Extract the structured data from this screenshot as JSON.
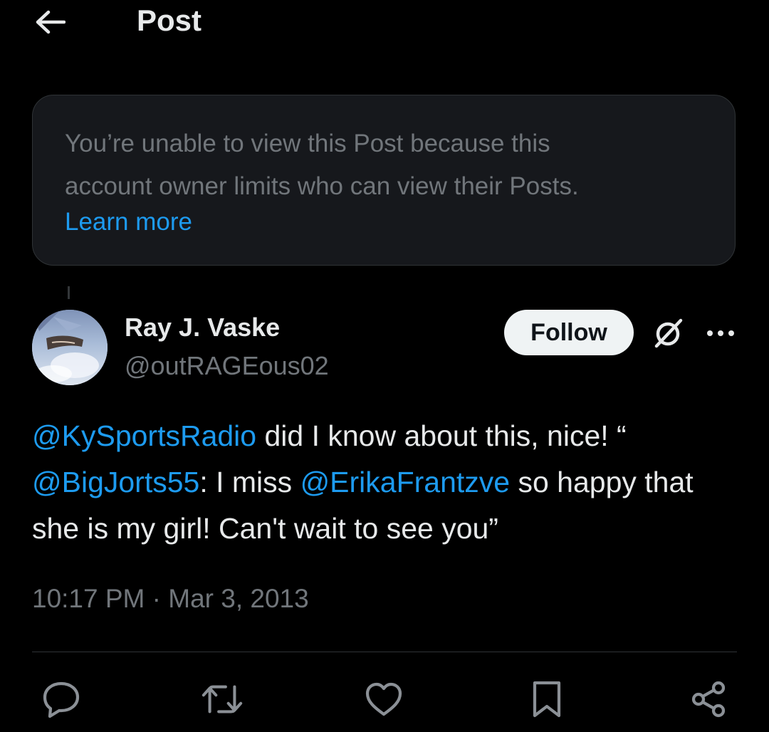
{
  "header": {
    "back_icon": "arrow-left-icon",
    "title": "Post"
  },
  "notice": {
    "message_line1": "You’re unable to view this Post because this",
    "message_line2": "account owner limits who can view their Posts.",
    "link_label": "Learn more"
  },
  "post": {
    "author": {
      "display_name": "Ray J. Vaske",
      "handle": "@outRAGEous02",
      "avatar_icon": "avatar-photo"
    },
    "follow_label": "Follow",
    "grok_icon": "grok-icon",
    "more_icon": "more-options-icon",
    "text_parts": {
      "m1": "@KySportsRadio",
      "t1": " did I know about this, nice! “",
      "m2": "@BigJorts55",
      "t2": ": I miss ",
      "m3": "@ErikaFrantzve",
      "t3": " so happy that she is my girl! Can't wait to see you”"
    },
    "time": "10:17 PM",
    "separator": "·",
    "date": "Mar 3, 2013"
  },
  "actions": {
    "reply_icon": "reply-icon",
    "repost_icon": "repost-icon",
    "like_icon": "like-icon",
    "bookmark_icon": "bookmark-icon",
    "share_icon": "share-icon"
  },
  "colors": {
    "background": "#000000",
    "primary_text": "#e7e9ea",
    "secondary_text": "#71767b",
    "link": "#1d9bf0",
    "notice_bg": "#16181c",
    "border": "#2f3336",
    "follow_bg": "#eff3f4"
  }
}
